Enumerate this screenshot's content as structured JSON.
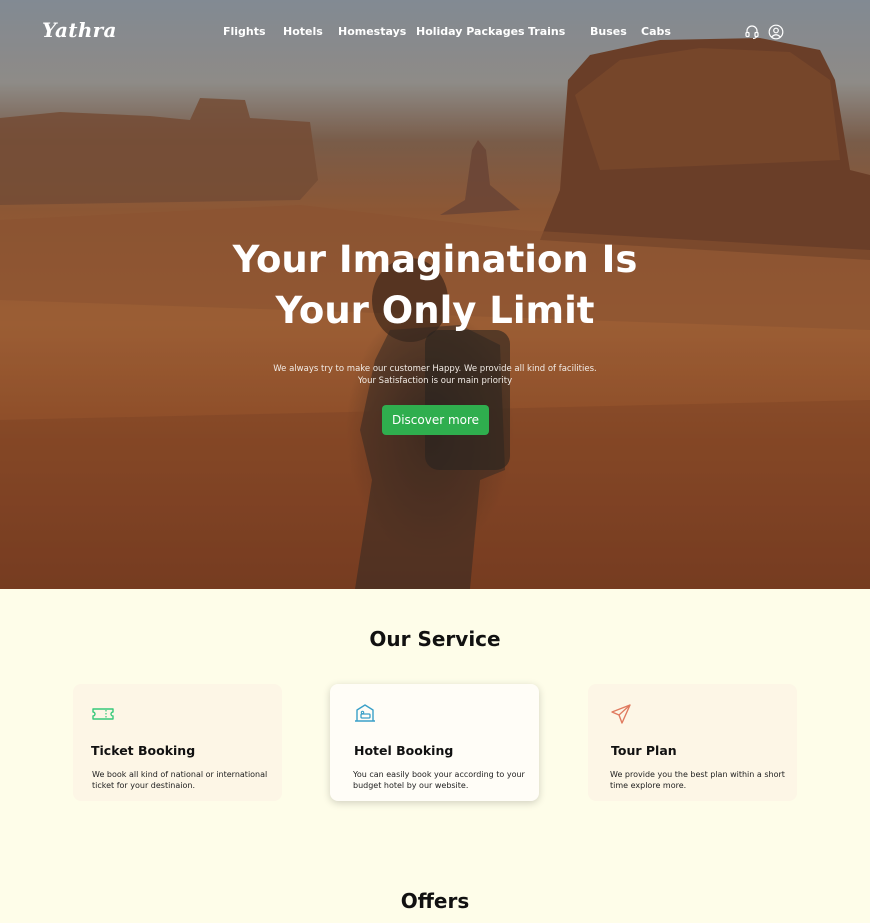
{
  "brand": {
    "logo": "Yathra"
  },
  "nav": {
    "items": [
      {
        "label": "Flights"
      },
      {
        "label": "Hotels"
      },
      {
        "label": "Homestays"
      },
      {
        "label": "Holiday Packages"
      },
      {
        "label": "Trains"
      },
      {
        "label": "Buses"
      },
      {
        "label": "Cabs"
      }
    ],
    "icons": [
      "headset-icon",
      "user-icon"
    ]
  },
  "hero": {
    "title_line1": "Your Imagination Is",
    "title_line2": "Your Only Limit",
    "subtitle_line1": "We always try to make our customer Happy. We provide all kind of facilities.",
    "subtitle_line2": "Your Satisfaction is our main priority",
    "cta_label": "Discover more",
    "cta_color": "#2fae4e"
  },
  "services": {
    "title": "Our Service",
    "cards": [
      {
        "icon": "ticket-icon",
        "icon_color": "#37c97a",
        "title": "Ticket Booking",
        "description": "We book all kind of national or international ticket for your destinaion."
      },
      {
        "icon": "hotel-bed-icon",
        "icon_color": "#3aa0c8",
        "title": "Hotel Booking",
        "description": "You can easily book your according to your budget hotel by our website."
      },
      {
        "icon": "paper-plane-icon",
        "icon_color": "#e07a5f",
        "title": "Tour Plan",
        "description": "We provide you the best plan within a short time explore more."
      }
    ]
  },
  "offers": {
    "title": "Offers"
  }
}
